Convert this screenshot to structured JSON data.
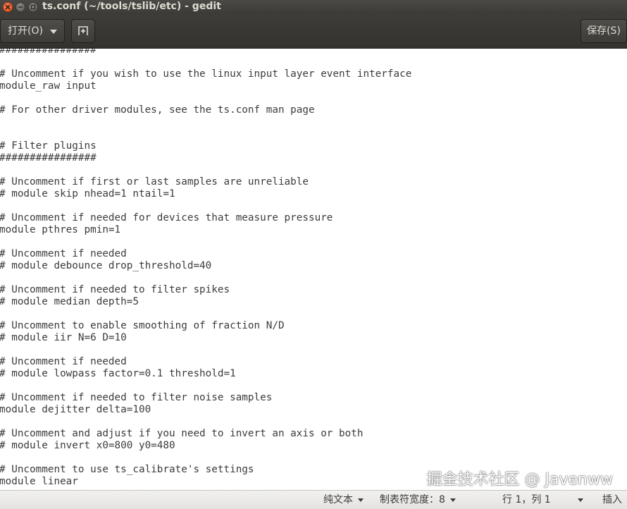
{
  "window": {
    "title": "ts.conf (~/tools/tslib/etc) - gedit"
  },
  "header": {
    "open_label": "打开(O)",
    "save_label": "保存(S)"
  },
  "editor": {
    "lines": [
      "################",
      "",
      "# Uncomment if you wish to use the linux input layer event interface",
      "module_raw input",
      "",
      "# For other driver modules, see the ts.conf man page",
      "",
      "",
      "# Filter plugins",
      "################",
      "",
      "# Uncomment if first or last samples are unreliable",
      "# module skip nhead=1 ntail=1",
      "",
      "# Uncomment if needed for devices that measure pressure",
      "module pthres pmin=1",
      "",
      "# Uncomment if needed",
      "# module debounce drop_threshold=40",
      "",
      "# Uncomment if needed to filter spikes",
      "# module median depth=5",
      "",
      "# Uncomment to enable smoothing of fraction N/D",
      "# module iir N=6 D=10",
      "",
      "# Uncomment if needed",
      "# module lowpass factor=0.1 threshold=1",
      "",
      "# Uncomment if needed to filter noise samples",
      "module dejitter delta=100",
      "",
      "# Uncomment and adjust if you need to invert an axis or both",
      "# module invert x0=800 y0=480",
      "",
      "# Uncomment to use ts_calibrate's settings",
      "module linear"
    ]
  },
  "watermark": "掘金技术社区 @ Javenww",
  "statusbar": {
    "language": "纯文本",
    "tab_width": "制表符宽度：8",
    "cursor_position": "行 1，列 1",
    "insert_mode": "插入"
  }
}
